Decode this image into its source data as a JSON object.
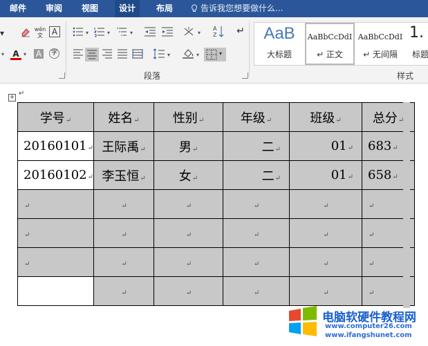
{
  "ribbon_tabs": [
    "邮件",
    "审阅",
    "视图",
    "设计",
    "布局"
  ],
  "tell_me": "告诉我您想要做什么...",
  "groups": {
    "paragraph": "段落",
    "styles": "样式"
  },
  "styles_gallery": [
    {
      "sample": "AaB",
      "name": "大标题"
    },
    {
      "sample": "AaBbCcDdI",
      "name": "↵ 正文"
    },
    {
      "sample": "AaBbCcDdI",
      "name": "↵ 无间隔"
    },
    {
      "sample": "1.",
      "name": "标题"
    }
  ],
  "table": {
    "headers": [
      "学号",
      "姓名",
      "性别",
      "年级",
      "班级",
      "总分"
    ],
    "rows": [
      [
        "20160101",
        "王际禹",
        "男",
        "二",
        "01",
        "683"
      ],
      [
        "20160102",
        "李玉恒",
        "女",
        "二",
        "01",
        "658"
      ]
    ],
    "para_mark": "↵"
  },
  "watermark": {
    "site": "电脑软硬件教程网",
    "url1": "www.computer26.com",
    "url2": "www.ifangshunet.com"
  },
  "colors": {
    "ribbon_blue": "#2b579a",
    "cell_shading": "#c8c8c8"
  }
}
